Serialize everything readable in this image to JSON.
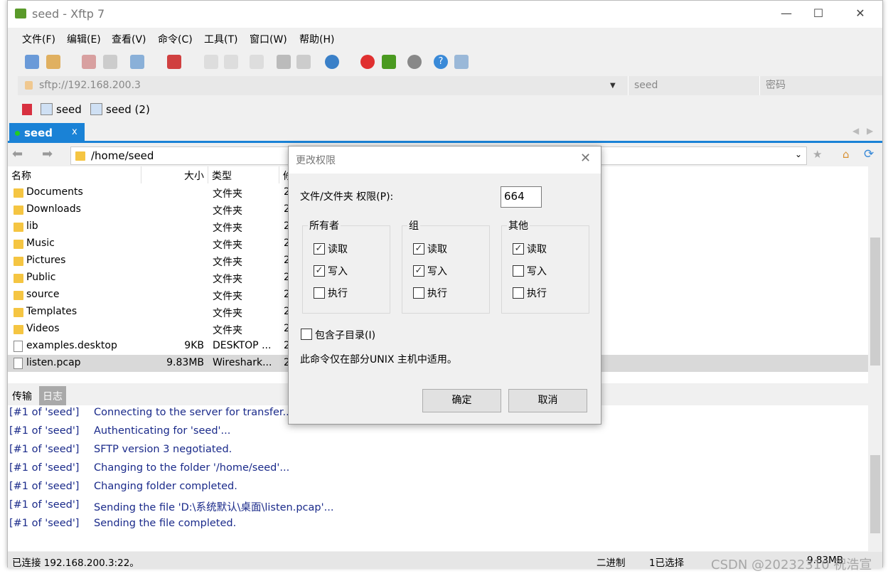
{
  "window": {
    "title": "seed - Xftp 7",
    "controls": [
      "—",
      "☐",
      "✕"
    ]
  },
  "menu": [
    "文件(F)",
    "编辑(E)",
    "查看(V)",
    "命令(C)",
    "工具(T)",
    "窗口(W)",
    "帮助(H)"
  ],
  "address": {
    "url": "sftp://192.168.200.3",
    "user_placeholder": "seed",
    "password_placeholder": "密码"
  },
  "links": [
    "seed",
    "seed (2)"
  ],
  "tab": {
    "label": "seed",
    "close": "x"
  },
  "path": "/home/seed",
  "columns": [
    "名称",
    "大小",
    "类型",
    "修"
  ],
  "files": [
    {
      "name": "Documents",
      "size": "",
      "type": "文件夹",
      "mod": "2",
      "icon": "folder"
    },
    {
      "name": "Downloads",
      "size": "",
      "type": "文件夹",
      "mod": "2",
      "icon": "folder"
    },
    {
      "name": "lib",
      "size": "",
      "type": "文件夹",
      "mod": "2",
      "icon": "folder"
    },
    {
      "name": "Music",
      "size": "",
      "type": "文件夹",
      "mod": "2",
      "icon": "folder"
    },
    {
      "name": "Pictures",
      "size": "",
      "type": "文件夹",
      "mod": "2",
      "icon": "folder"
    },
    {
      "name": "Public",
      "size": "",
      "type": "文件夹",
      "mod": "2",
      "icon": "folder"
    },
    {
      "name": "source",
      "size": "",
      "type": "文件夹",
      "mod": "2",
      "icon": "folder"
    },
    {
      "name": "Templates",
      "size": "",
      "type": "文件夹",
      "mod": "2",
      "icon": "folder"
    },
    {
      "name": "Videos",
      "size": "",
      "type": "文件夹",
      "mod": "2",
      "icon": "folder"
    },
    {
      "name": "examples.desktop",
      "size": "9KB",
      "type": "DESKTOP ...",
      "mod": "2",
      "icon": "file"
    },
    {
      "name": "listen.pcap",
      "size": "9.83MB",
      "type": "Wireshark...",
      "mod": "2",
      "icon": "file",
      "selected": true
    }
  ],
  "log_tabs": [
    "传输",
    "日志"
  ],
  "log": [
    {
      "src": "[#1 of 'seed']",
      "msg": "Connecting to the server for transfer..."
    },
    {
      "src": "[#1 of 'seed']",
      "msg": "Authenticating for 'seed'..."
    },
    {
      "src": "[#1 of 'seed']",
      "msg": "SFTP version 3 negotiated."
    },
    {
      "src": "[#1 of 'seed']",
      "msg": "Changing to the folder '/home/seed'..."
    },
    {
      "src": "[#1 of 'seed']",
      "msg": "Changing folder completed."
    },
    {
      "src": "[#1 of 'seed']",
      "msg": "Sending the file 'D:\\系统默认\\桌面\\listen.pcap'..."
    },
    {
      "src": "[#1 of 'seed']",
      "msg": "Sending the file completed."
    }
  ],
  "status": {
    "connection": "已连接 192.168.200.3:22。",
    "mode": "二进制",
    "selected": "1已选择",
    "size": "9.83MB"
  },
  "watermark": "CSDN @2023231​0 祝浩宣",
  "dialog": {
    "title": "更改权限",
    "perm_label": "文件/文件夹 权限(P):",
    "perm_value": "664",
    "groups": [
      {
        "label": "所有者",
        "read": true,
        "write": true,
        "exec": false
      },
      {
        "label": "组",
        "read": true,
        "write": true,
        "exec": false
      },
      {
        "label": "其他",
        "read": true,
        "write": false,
        "exec": false
      }
    ],
    "opt_labels": [
      "读取",
      "写入",
      "执行"
    ],
    "recursive_label": "包含子目录(I)",
    "recursive": false,
    "note": "此命令仅在部分UNIX 主机中适用。",
    "ok": "确定",
    "cancel": "取消"
  }
}
